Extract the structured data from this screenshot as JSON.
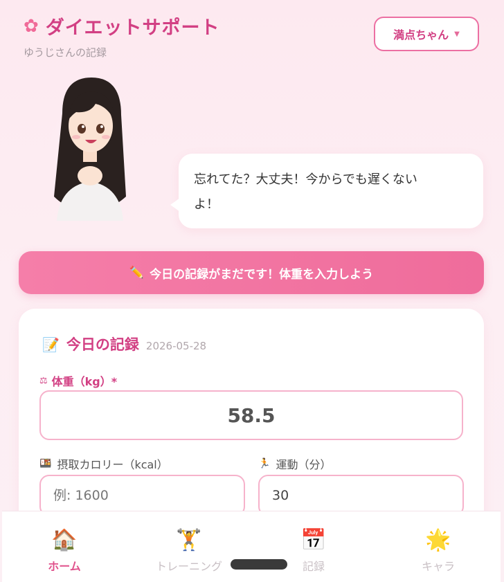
{
  "header": {
    "icon": "sakura-icon",
    "title": "ダイエットサポート",
    "subtitle": "ゆうじさんの記録",
    "character_select": "満点ちゃん"
  },
  "speech": {
    "text_line1": "忘れてた？大丈夫！今からでも遅くない",
    "text_line2": "よ！"
  },
  "alert": {
    "icon": "pencil-icon",
    "text": "今日の記録がまだです！体重を入力しよう"
  },
  "record_card": {
    "title": "今日の記録",
    "date": "2026-05-28",
    "weight_label": "体重（kg）*",
    "weight_value": "58.5",
    "calorie_label": "摂取カロリー（kcal）",
    "calorie_placeholder": "例: 1600",
    "exercise_label": "運動（分）",
    "exercise_value": "30"
  },
  "nav": {
    "items": [
      {
        "label": "ホーム",
        "icon": "house-icon",
        "active": true
      },
      {
        "label": "トレーニング",
        "icon": "weightlifter-icon",
        "active": false
      },
      {
        "label": "記録",
        "icon": "calendar-icon",
        "active": false
      },
      {
        "label": "キャラ",
        "icon": "star-icon",
        "active": false
      }
    ]
  },
  "colors": {
    "accent": "#d23f83",
    "banner": "#f07aa6",
    "border": "#f6b2cb"
  }
}
